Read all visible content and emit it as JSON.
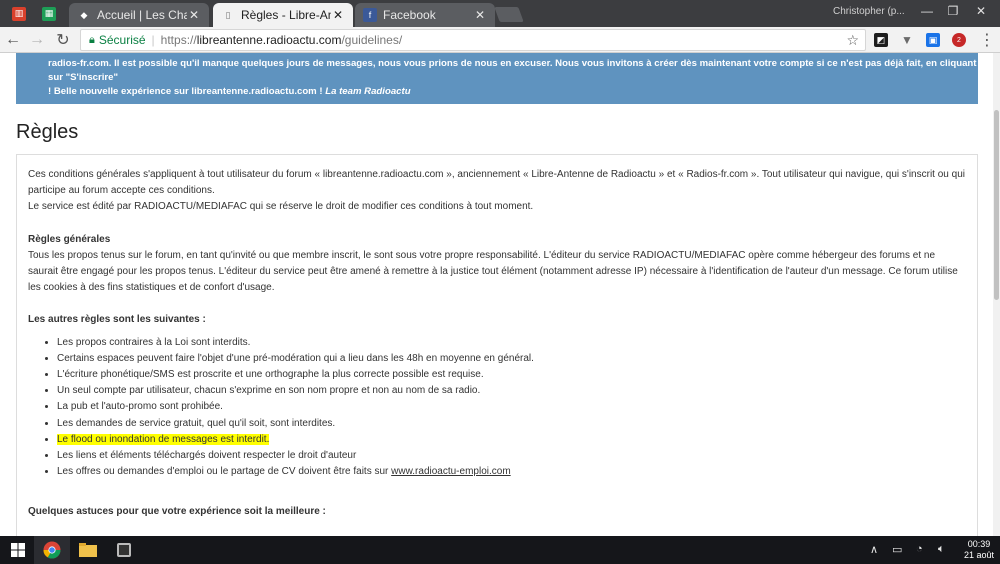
{
  "browser": {
    "tabs": [
      {
        "title": "Accueil | Les Chacals - Én",
        "active": false
      },
      {
        "title": "Règles - Libre-Antenne",
        "active": true
      },
      {
        "title": "Facebook",
        "active": false
      }
    ],
    "profile_name": "Christopher (p...",
    "security_label": "Sécurisé",
    "url_scheme": "https://",
    "url_host": "libreantenne.radioactu.com",
    "url_path": "/guidelines/",
    "extension_badge": "2"
  },
  "banner": {
    "line1": "radios-fr.com. Il est possible qu'il manque quelques jours de messages, nous vous prions de nous en excuser. Nous vous invitons à créer dès maintenant votre compte si ce n'est pas déjà fait, en cliquant sur \"S'inscrire\"",
    "line2_bold": "! Belle nouvelle expérience sur libreantenne.radioactu.com !",
    "line2_italic": "La team Radioactu",
    "color": "#5f93bf"
  },
  "page": {
    "title": "Règles",
    "intro": [
      "Ces conditions générales s'appliquent à tout utilisateur du forum « libreantenne.radioactu.com », anciennement « Libre-Antenne de Radioactu » et « Radios-fr.com ». Tout utilisateur qui navigue, qui s'inscrit ou qui participe au forum accepte ces conditions.",
      "Le service est édité par RADIOACTU/MEDIAFAC qui se réserve le droit de modifier ces conditions à tout moment."
    ],
    "general_heading": "Règles générales",
    "general_text": "Tous les propos tenus sur le forum, en tant qu'invité ou que membre inscrit, le sont sous votre propre responsabilité. L'éditeur du service RADIOACTU/MEDIAFAC opère comme hébergeur des forums et ne saurait être engagé pour les propos tenus. L'éditeur du service peut être amené à remettre à la justice tout élément (notamment adresse IP) nécessaire à l'identification de l'auteur d'un message. Ce forum utilise les cookies à des fins statistiques et de confort d'usage.",
    "other_rules_heading": "Les autres règles sont les suivantes :",
    "rules": [
      "Les propos contraires à la Loi sont interdits.",
      "Certains espaces peuvent faire l'objet d'une pré-modération qui a lieu dans les 48h en moyenne en général.",
      "L'écriture phonétique/SMS est proscrite et une orthographe la plus correcte possible est requise.",
      "Un seul compte par utilisateur, chacun s'exprime en son nom propre et non au nom de sa radio.",
      "La pub et l'auto-promo sont prohibée.",
      "Les demandes de service gratuit, quel qu'il soit, sont interdites.",
      "Le flood ou inondation de messages est interdit.",
      "Les liens et éléments téléchargés doivent respecter le droit d'auteur"
    ],
    "last_rule_prefix": "Les offres ou demandes d'emploi ou le partage de CV doivent être faits sur ",
    "last_rule_link": "www.radioactu-emploi.com",
    "tips_heading": "Quelques astuces pour que votre expérience soit la meilleure :",
    "highlight_color": "#ffff00"
  },
  "taskbar": {
    "time": "00:39",
    "date": "21 août"
  }
}
